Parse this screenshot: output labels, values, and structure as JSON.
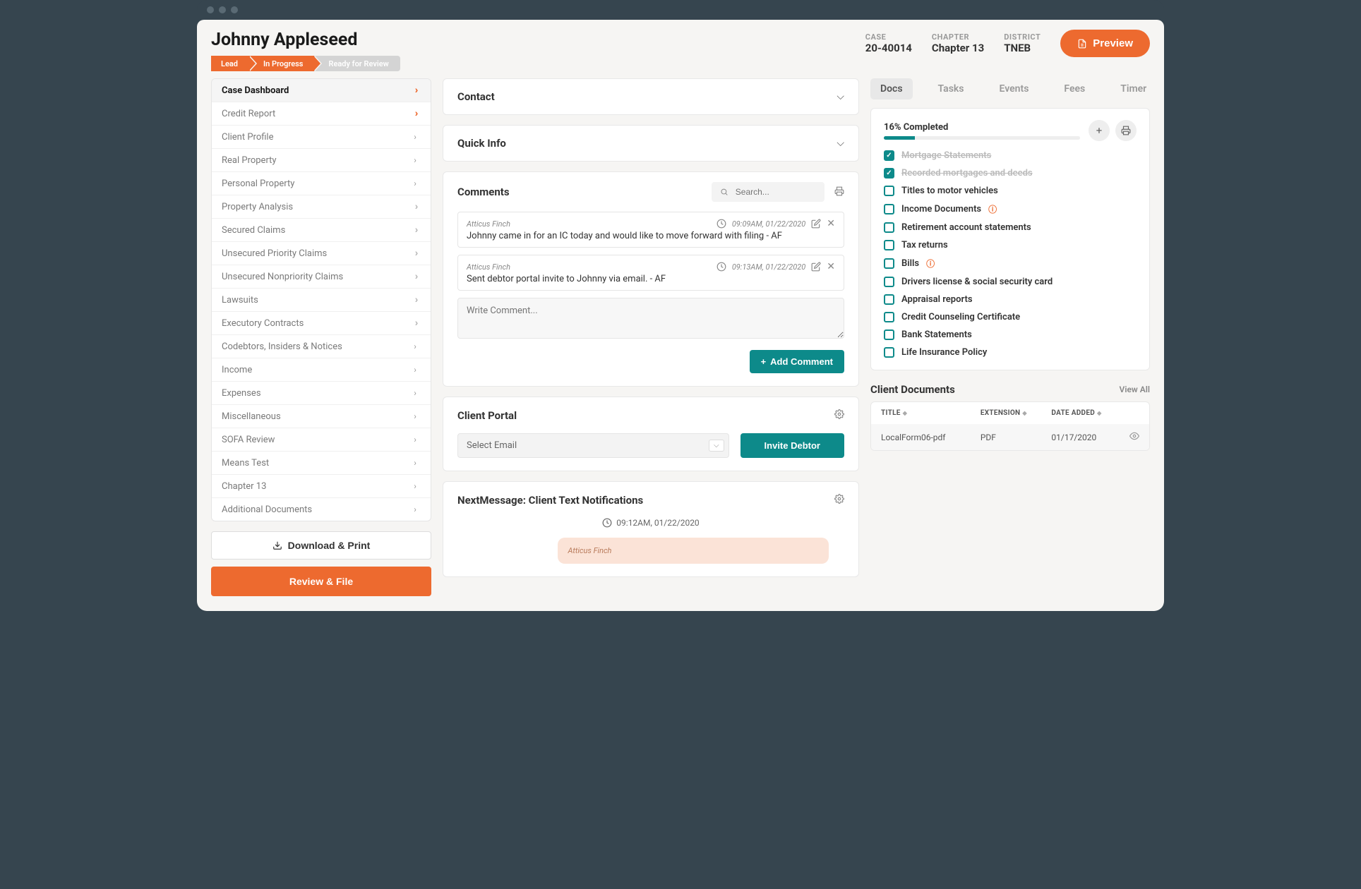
{
  "header": {
    "title": "Johnny Appleseed",
    "stages": [
      "Lead",
      "In Progress",
      "Ready for Review"
    ],
    "meta": {
      "case_label": "CASE",
      "case_value": "20-40014",
      "chapter_label": "CHAPTER",
      "chapter_value": "Chapter 13",
      "district_label": "DISTRICT",
      "district_value": "TNEB"
    },
    "preview_label": "Preview"
  },
  "sidebar": {
    "items": [
      {
        "label": "Case Dashboard",
        "icon": "double-orange",
        "active": true
      },
      {
        "label": "Credit Report",
        "icon": "double-orange"
      },
      {
        "label": "Client Profile",
        "icon": "single-gray"
      },
      {
        "label": "Real Property",
        "icon": "single-gray"
      },
      {
        "label": "Personal Property",
        "icon": "single-gray"
      },
      {
        "label": "Property Analysis",
        "icon": "double-gray"
      },
      {
        "label": "Secured Claims",
        "icon": "double-gray"
      },
      {
        "label": "Unsecured Priority Claims",
        "icon": "double-gray"
      },
      {
        "label": "Unsecured Nonpriority Claims",
        "icon": "double-gray"
      },
      {
        "label": "Lawsuits",
        "icon": "double-gray"
      },
      {
        "label": "Executory Contracts",
        "icon": "double-gray"
      },
      {
        "label": "Codebtors, Insiders & Notices",
        "icon": "single-gray"
      },
      {
        "label": "Income",
        "icon": "single-gray"
      },
      {
        "label": "Expenses",
        "icon": "single-gray"
      },
      {
        "label": "Miscellaneous",
        "icon": "single-gray"
      },
      {
        "label": "SOFA Review",
        "icon": "single-gray"
      },
      {
        "label": "Means Test",
        "icon": "single-gray"
      },
      {
        "label": "Chapter 13",
        "icon": "single-gray"
      },
      {
        "label": "Additional Documents",
        "icon": "single-gray"
      }
    ],
    "download_label": "Download & Print",
    "review_label": "Review & File"
  },
  "main": {
    "contact_title": "Contact",
    "quickinfo_title": "Quick Info",
    "comments": {
      "title": "Comments",
      "search_placeholder": "Search...",
      "list": [
        {
          "author": "Atticus Finch",
          "time": "09:09AM, 01/22/2020",
          "body": "Johnny came in for an IC today and would like to move forward with filing - AF"
        },
        {
          "author": "Atticus Finch",
          "time": "09:13AM, 01/22/2020",
          "body": "Sent debtor portal invite to Johnny via email. - AF"
        }
      ],
      "input_placeholder": "Write Comment...",
      "add_label": "Add Comment"
    },
    "portal": {
      "title": "Client Portal",
      "select_placeholder": "Select Email",
      "invite_label": "Invite Debtor"
    },
    "nextmsg": {
      "title": "NextMessage: Client Text Notifications",
      "time": "09:12AM, 01/22/2020",
      "chat_author": "Atticus Finch"
    }
  },
  "right": {
    "tabs": [
      "Docs",
      "Tasks",
      "Events",
      "Fees",
      "Timer"
    ],
    "progress_label": "16% Completed",
    "progress_pct": 16,
    "docs": [
      {
        "label": "Mortgage Statements",
        "done": true
      },
      {
        "label": "Recorded mortgages and deeds",
        "done": true
      },
      {
        "label": "Titles to motor vehicles",
        "done": false
      },
      {
        "label": "Income Documents",
        "done": false,
        "warn": true
      },
      {
        "label": "Retirement account statements",
        "done": false
      },
      {
        "label": "Tax returns",
        "done": false
      },
      {
        "label": "Bills",
        "done": false,
        "warn": true
      },
      {
        "label": "Drivers license & social security card",
        "done": false
      },
      {
        "label": "Appraisal reports",
        "done": false
      },
      {
        "label": "Credit Counseling Certificate",
        "done": false
      },
      {
        "label": "Bank Statements",
        "done": false
      },
      {
        "label": "Life Insurance Policy",
        "done": false
      }
    ],
    "client_docs": {
      "title": "Client Documents",
      "view_all": "View All",
      "headers": {
        "title": "TITLE",
        "ext": "EXTENSION",
        "date": "DATE ADDED"
      },
      "rows": [
        {
          "title": "LocalForm06-pdf",
          "ext": "PDF",
          "date": "01/17/2020"
        }
      ]
    }
  }
}
